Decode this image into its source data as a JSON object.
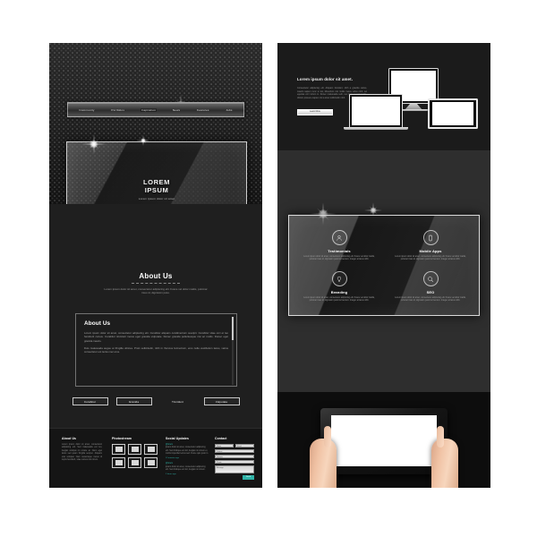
{
  "left_panel": {
    "nav": {
      "items": [
        {
          "label": "Community",
          "active": false
        },
        {
          "label": "Portfolios",
          "active": false
        },
        {
          "label": "Inspiration",
          "active": true
        },
        {
          "label": "News",
          "active": false
        },
        {
          "label": "Features",
          "active": false
        },
        {
          "label": "Jobs",
          "active": false
        }
      ]
    },
    "hero": {
      "title_line1": "LOREM",
      "title_line2": "IPSUM",
      "subtitle": "Lorem ipsum dolor sit amet"
    },
    "about": {
      "heading": "About Us",
      "subtitle": "Lorem ipsum dolor sit amet, consectetur adipiscing elit. Fusce vel dolor mattis, pulvinar risus id, dignissim justo.",
      "box_heading": "About Us",
      "paragraph1": "Lorem ipsum dolor sit amet, consectetur adipiscing elit. Curabitur aliquam condimentum suscipit. Curabitur vitae orci et leo hendrerit cursus. Curabitur tincidunt metus eget gravida vulputate. Donec gravida pellentesque nisi ac mollis. Donec eget gravida mauris.",
      "paragraph2": "Duis malesuada augue at fringilla ultrices. Proin sollicitudin, nibh in rhoncus fermentum, eros nulla vestibulum lacus, varius consectetur est lectus nec eros.",
      "buttons": [
        {
          "label": "Curabitur",
          "ghost": false
        },
        {
          "label": "Gravida",
          "ghost": false
        },
        {
          "label": "Tincidunt",
          "ghost": true
        },
        {
          "label": "Vulputate",
          "ghost": false
        }
      ]
    },
    "footer": {
      "about": {
        "title": "About Us",
        "text": "Lorem ipsum dolor sit amet, consectetur adipiscing elit. Sed malesuada est leo, feugiat volutpat mi ornare at. Nunc eget lacus sed quam fringilla semper. Aliquam erat volutpat. Nam scelerisque metus id turpis hendrerit, vitae cursus nisl rutrum."
      },
      "photostream": {
        "title": "Photostream",
        "thumb_count": 6
      },
      "social": {
        "title": "Social Updates",
        "items": [
          {
            "link": "@lorem",
            "text": "ipsum dolor sit amet, consectetur adipiscing elit. Sed tristique est nisl, feugiat non lorem et, mollis imperdiet lectus sed. Fusce quis justo in.",
            "date": "12 minutes ago"
          },
          {
            "link": "@lorem",
            "text": "ipsum dolor sit amet, consectetur adipiscing elit. Sed tristique est nisl, feugiat non lorem.",
            "date": "2 hours ago"
          }
        ]
      },
      "contact": {
        "title": "Contact",
        "field_name": "Name",
        "field_email": "Email",
        "field_subject": "Subject",
        "field_website": "Website",
        "field_phone": "Phone",
        "field_message": "Message",
        "send_label": "Send"
      }
    }
  },
  "right_panel": {
    "hero": {
      "heading": "Lorem ipsum dolor sit amet.",
      "paragraph": "Consectetur adipiscing elit. Aliquam tincidunt, nibh a gravida varius, mauris sapien nunc ut dui, bibendum nisi mollis metus tellus nibh, vel egestas orci rutrum in. Donec malesuada velit, nec laoreet malesuada, dictum posuere sapien nisi a amet sollicitudin nibh.",
      "button_label": "Learn More"
    },
    "devices": {
      "monitor": "desktop-monitor",
      "laptop": "laptop",
      "tablet": "tablet"
    },
    "features": [
      {
        "icon": "person-icon",
        "title": "Testimonials",
        "text": "Lorem ipsum dolor sit amet, consectetur adipiscing elit. Fusce vel dolor mattis, pulvinar risus id, dignissim justo fermentum. Integer at lacus nibh."
      },
      {
        "icon": "mobile-phone-icon",
        "title": "Mobile Apps",
        "text": "Lorem ipsum dolor sit amet, consectetur adipiscing elit. Fusce vel dolor mattis, pulvinar risus id, dignissim justo fermentum. Integer at lacus nibh."
      },
      {
        "icon": "lightbulb-icon",
        "title": "Branding",
        "text": "Lorem ipsum dolor sit amet, consectetur adipiscing elit. Fusce vel dolor mattis, pulvinar risus id, dignissim justo fermentum. Integer at lacus nibh."
      },
      {
        "icon": "magnifier-icon",
        "title": "SEO",
        "text": "Lorem ipsum dolor sit amet, consectetur adipiscing elit. Fusce vel dolor mattis, pulvinar risus id, dignissim justo fermentum. Integer at lacus nibh."
      }
    ],
    "tablet_mockup": {
      "name": "hands-holding-tablet",
      "screen": "blank-white-screen"
    }
  },
  "colors": {
    "accent_teal": "#2fb3a8",
    "panel_dark": "#1c1c1c",
    "panel_darker": "#0d0d0d",
    "text_light": "#ffffff",
    "text_muted": "#8d8d8d"
  }
}
